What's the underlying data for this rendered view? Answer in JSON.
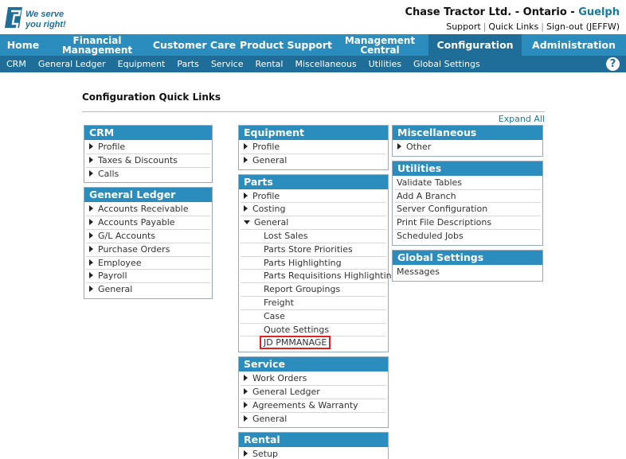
{
  "header": {
    "logo_text": "We serve you right!",
    "company": "Chase Tractor Ltd. - Ontario -",
    "location": "Guelph",
    "links": [
      "Support",
      "Quick Links",
      "Sign-out (JEFFW)"
    ]
  },
  "main_nav": [
    {
      "label": "Home"
    },
    {
      "label": "Financial Management"
    },
    {
      "label": "Customer Care"
    },
    {
      "label": "Product Support"
    },
    {
      "label": "Management Central"
    },
    {
      "label": "Configuration"
    },
    {
      "label": "Administration"
    }
  ],
  "sub_nav": [
    "CRM",
    "General Ledger",
    "Equipment",
    "Parts",
    "Service",
    "Rental",
    "Miscellaneous",
    "Utilities",
    "Global Settings"
  ],
  "help_icon": "?",
  "page": {
    "title": "Configuration Quick Links",
    "expand_all": "Expand All"
  },
  "panels": {
    "crm": {
      "title": "CRM",
      "items": [
        "Profile",
        "Taxes & Discounts",
        "Calls"
      ]
    },
    "general_ledger": {
      "title": "General Ledger",
      "items": [
        "Accounts Receivable",
        "Accounts Payable",
        "G/L Accounts",
        "Purchase Orders",
        "Employee",
        "Payroll",
        "General"
      ]
    },
    "equipment": {
      "title": "Equipment",
      "items": [
        "Profile",
        "General"
      ]
    },
    "parts": {
      "title": "Parts",
      "items": [
        "Profile",
        "Costing",
        "General"
      ],
      "general_sub": [
        "Lost Sales",
        "Parts Store Priorities",
        "Parts Highlighting",
        "Parts Requisitions Highlighting",
        "Report Groupings",
        "Freight",
        "Case",
        "Quote Settings",
        "JD PMMANAGE"
      ]
    },
    "service": {
      "title": "Service",
      "items": [
        "Work Orders",
        "General Ledger",
        "Agreements & Warranty",
        "General"
      ]
    },
    "rental": {
      "title": "Rental",
      "items": [
        "Setup"
      ]
    },
    "miscellaneous": {
      "title": "Miscellaneous",
      "items": [
        "Other"
      ]
    },
    "utilities": {
      "title": "Utilities",
      "items": [
        "Validate Tables",
        "Add A Branch",
        "Server Configuration",
        "Print File Descriptions",
        "Scheduled Jobs"
      ]
    },
    "global_settings": {
      "title": "Global Settings",
      "items": [
        "Messages"
      ]
    }
  }
}
